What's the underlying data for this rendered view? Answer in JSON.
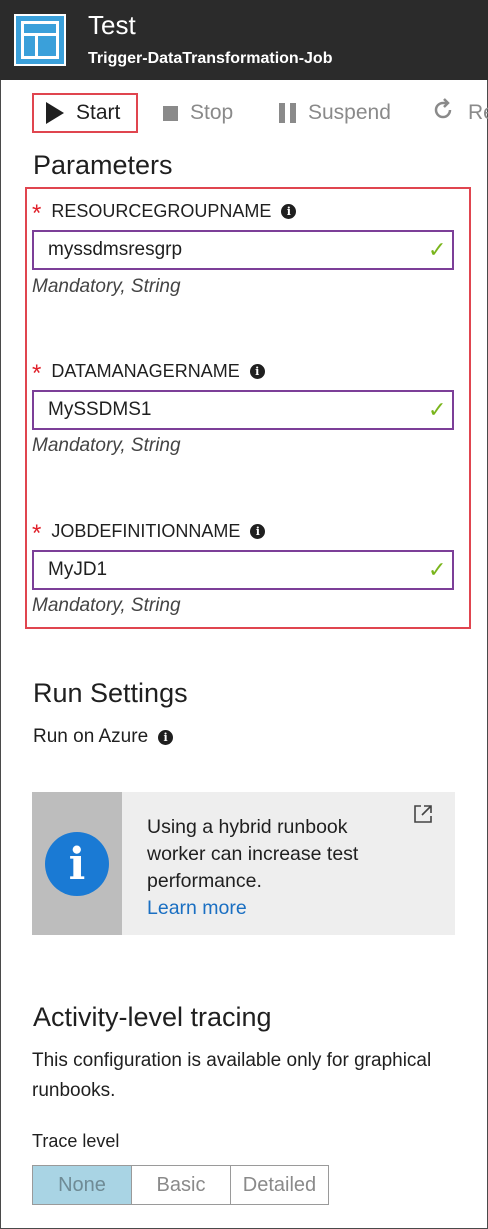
{
  "header": {
    "title": "Test",
    "subtitle": "Trigger-DataTransformation-Job"
  },
  "toolbar": {
    "start_label": "Start",
    "stop_label": "Stop",
    "suspend_label": "Suspend",
    "resume_label": "Re"
  },
  "parameters": {
    "heading": "Parameters",
    "items": [
      {
        "name": "RESOURCEGROUPNAME",
        "value": "myssdmsresgrp",
        "hint": "Mandatory, String",
        "required_mark": "*"
      },
      {
        "name": "DATAMANAGERNAME",
        "value": "MySSDMS1",
        "hint": "Mandatory, String",
        "required_mark": "*"
      },
      {
        "name": "JOBDEFINITIONNAME",
        "value": "MyJD1",
        "hint": "Mandatory, String",
        "required_mark": "*"
      }
    ]
  },
  "run_settings": {
    "heading": "Run Settings",
    "run_on": "Run on Azure"
  },
  "banner": {
    "icon_letter": "i",
    "text": "Using a hybrid runbook worker can increase test performance.",
    "link": "Learn more"
  },
  "tracing": {
    "heading": "Activity-level tracing",
    "description": "This configuration is available only for graphical runbooks.",
    "level_label": "Trace level",
    "options": [
      "None",
      "Basic",
      "Detailed"
    ],
    "selected": "None"
  },
  "icons": {
    "header": "runbook-icon",
    "start": "play-icon",
    "stop": "stop-icon",
    "suspend": "pause-icon",
    "resume": "resume-icon",
    "info": "info-icon",
    "check": "checkmark-icon",
    "external": "external-link-icon"
  },
  "colors": {
    "header_bg": "#2b2b2b",
    "highlight": "#e0454f",
    "input_border": "#7c3f98",
    "check": "#7ab51d",
    "link": "#1a6fc2",
    "info_blue": "#1a7ad4",
    "selected_option": "#a9d4e4"
  }
}
